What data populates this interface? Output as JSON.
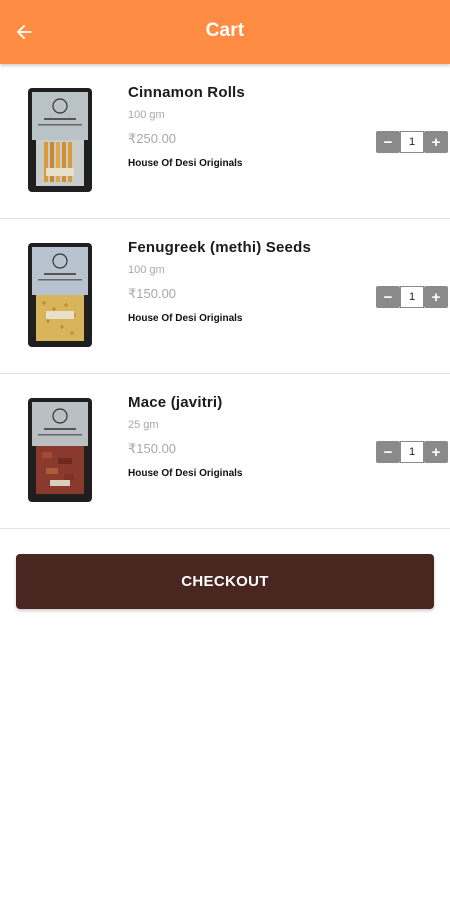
{
  "header": {
    "title": "Cart",
    "back_icon": "arrow-left-icon",
    "color": "#ff8c42"
  },
  "items": [
    {
      "name": "Cinnamon Rolls",
      "weight": "100 gm",
      "price": "₹250.00",
      "brand": "House Of Desi Originals",
      "quantity": "1",
      "minus": "−",
      "plus": "+"
    },
    {
      "name": "Fenugreek (methi) Seeds",
      "weight": "100 gm",
      "price": "₹150.00",
      "brand": "House Of Desi Originals",
      "quantity": "1",
      "minus": "−",
      "plus": "+"
    },
    {
      "name": "Mace (javitri)",
      "weight": "25 gm",
      "price": "₹150.00",
      "brand": "House Of Desi Originals",
      "quantity": "1",
      "minus": "−",
      "plus": "+"
    }
  ],
  "checkout": {
    "label": "CHECKOUT",
    "color": "#4a2620"
  }
}
